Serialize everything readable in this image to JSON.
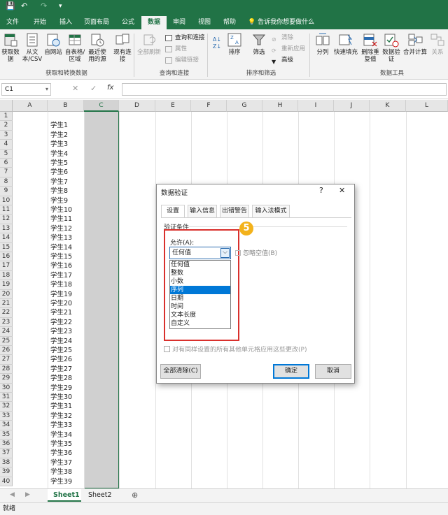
{
  "quick_access": {
    "save_icon": "save-icon",
    "undo_icon": "undo-icon",
    "redo_icon": "redo-icon",
    "customize_icon": "customize-icon"
  },
  "tabs": [
    "文件",
    "开始",
    "插入",
    "页面布局",
    "公式",
    "数据",
    "审阅",
    "视图",
    "帮助"
  ],
  "active_tab": "数据",
  "tell_me": "告诉我你想要做什么",
  "ribbon": {
    "get_data": "获取数据",
    "from_text": "从文本/CSV",
    "from_web": "自网站",
    "from_table": "自表格/区域",
    "recent_sources": "最近使用的源",
    "existing_conn": "现有连接",
    "group_get": "获取和转换数据",
    "refresh_all": "全部刷新",
    "queries_conn": "查询和连接",
    "properties": "属性",
    "edit_links": "编辑链接",
    "group_queries": "查询和连接",
    "sort": "排序",
    "filter": "筛选",
    "clear": "清除",
    "reapply": "重新应用",
    "advanced": "高级",
    "group_sort": "排序和筛选",
    "text_to_cols": "分列",
    "flash_fill": "快速填充",
    "remove_dup": "删除重复值",
    "data_validation": "数据验证",
    "consolidate": "合并计算",
    "relationships": "关系",
    "group_tools": "数据工具"
  },
  "formula_bar": {
    "name_box": "C1",
    "cancel": "✕",
    "enter": "✓",
    "fx": "fx",
    "value": ""
  },
  "columns": [
    "A",
    "B",
    "C",
    "D",
    "E",
    "F",
    "G",
    "H",
    "I",
    "J",
    "K",
    "L"
  ],
  "selected_column": "C",
  "rows": [
    1,
    2,
    3,
    4,
    5,
    6,
    7,
    8,
    9,
    10,
    11,
    12,
    13,
    14,
    15,
    16,
    17,
    18,
    19,
    20,
    21,
    22,
    23,
    24,
    25,
    26,
    27,
    28,
    29,
    30,
    31,
    32,
    33,
    34,
    35,
    36,
    37,
    38,
    39,
    40
  ],
  "b_values": [
    "",
    "学生1",
    "学生2",
    "学生3",
    "学生4",
    "学生5",
    "学生6",
    "学生7",
    "学生8",
    "学生9",
    "学生10",
    "学生11",
    "学生12",
    "学生13",
    "学生14",
    "学生15",
    "学生16",
    "学生17",
    "学生18",
    "学生19",
    "学生20",
    "学生21",
    "学生22",
    "学生23",
    "学生24",
    "学生25",
    "学生26",
    "学生27",
    "学生28",
    "学生29",
    "学生30",
    "学生31",
    "学生32",
    "学生33",
    "学生34",
    "学生35",
    "学生36",
    "学生37",
    "学生38",
    "学生39"
  ],
  "sheets": [
    "Sheet1",
    "Sheet2"
  ],
  "active_sheet": "Sheet1",
  "status": "就绪",
  "dialog": {
    "title": "数据验证",
    "help": "?",
    "close": "✕",
    "tabs": [
      "设置",
      "输入信息",
      "出错警告",
      "输入法模式"
    ],
    "active_tab": "设置",
    "section": "验证条件",
    "allow_label": "允许(A):",
    "allow_value": "任何值",
    "ignore_blank": "忽略空值(B)",
    "options": [
      "任何值",
      "整数",
      "小数",
      "序列",
      "日期",
      "时间",
      "文本长度",
      "自定义"
    ],
    "selected_option": "序列",
    "apply_all": "对有同样设置的所有其他单元格应用这些更改(P)",
    "clear_all": "全部清除(C)",
    "ok": "确定",
    "cancel": "取消"
  },
  "step_badge": "5",
  "colors": {
    "accent": "#217346",
    "highlight": "#d9302c",
    "badge": "#f3b21b",
    "selection": "#0078d7"
  }
}
